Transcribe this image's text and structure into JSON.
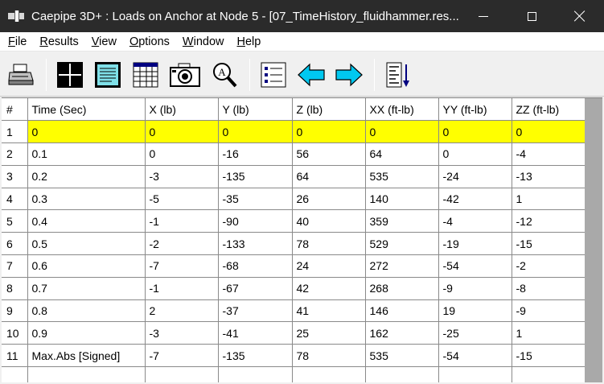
{
  "window": {
    "title": "Caepipe 3D+ : Loads on Anchor at Node 5 -  [07_TimeHistory_fluidhammer.res..."
  },
  "menu": [
    {
      "label": "File",
      "key": "F",
      "rest": "ile"
    },
    {
      "label": "Results",
      "key": "R",
      "rest": "esults"
    },
    {
      "label": "View",
      "key": "V",
      "rest": "iew"
    },
    {
      "label": "Options",
      "key": "O",
      "rest": "ptions"
    },
    {
      "label": "Window",
      "key": "W",
      "rest": "indow"
    },
    {
      "label": "Help",
      "key": "H",
      "rest": "elp"
    }
  ],
  "toolbar": [
    "print-icon",
    "grid-icon",
    "document-icon",
    "table-icon",
    "camera-icon",
    "zoom-icon",
    "list-icon",
    "arrow-left-icon",
    "arrow-right-icon",
    "sort-icon"
  ],
  "colors": {
    "highlight": "#ffff00",
    "arrow": "#00c8f0"
  },
  "table": {
    "headers": [
      "#",
      "Time (Sec)",
      "X (lb)",
      "Y (lb)",
      "Z (lb)",
      "XX (ft-lb)",
      "YY (ft-lb)",
      "ZZ (ft-lb)"
    ],
    "rows": [
      [
        "1",
        "0",
        "0",
        "0",
        "0",
        "0",
        "0",
        "0"
      ],
      [
        "2",
        "0.1",
        "0",
        "-16",
        "56",
        "64",
        "0",
        "-4"
      ],
      [
        "3",
        "0.2",
        "-3",
        "-135",
        "64",
        "535",
        "-24",
        "-13"
      ],
      [
        "4",
        "0.3",
        "-5",
        "-35",
        "26",
        "140",
        "-42",
        "1"
      ],
      [
        "5",
        "0.4",
        "-1",
        "-90",
        "40",
        "359",
        "-4",
        "-12"
      ],
      [
        "6",
        "0.5",
        "-2",
        "-133",
        "78",
        "529",
        "-19",
        "-15"
      ],
      [
        "7",
        "0.6",
        "-7",
        "-68",
        "24",
        "272",
        "-54",
        "-2"
      ],
      [
        "8",
        "0.7",
        "-1",
        "-67",
        "42",
        "268",
        "-9",
        "-8"
      ],
      [
        "9",
        "0.8",
        "2",
        "-37",
        "41",
        "146",
        "19",
        "-9"
      ],
      [
        "10",
        "0.9",
        "-3",
        "-41",
        "25",
        "162",
        "-25",
        "1"
      ],
      [
        "11",
        "Max.Abs [Signed]",
        "-7",
        "-135",
        "78",
        "535",
        "-54",
        "-15"
      ]
    ],
    "highlighted_row": 0
  }
}
